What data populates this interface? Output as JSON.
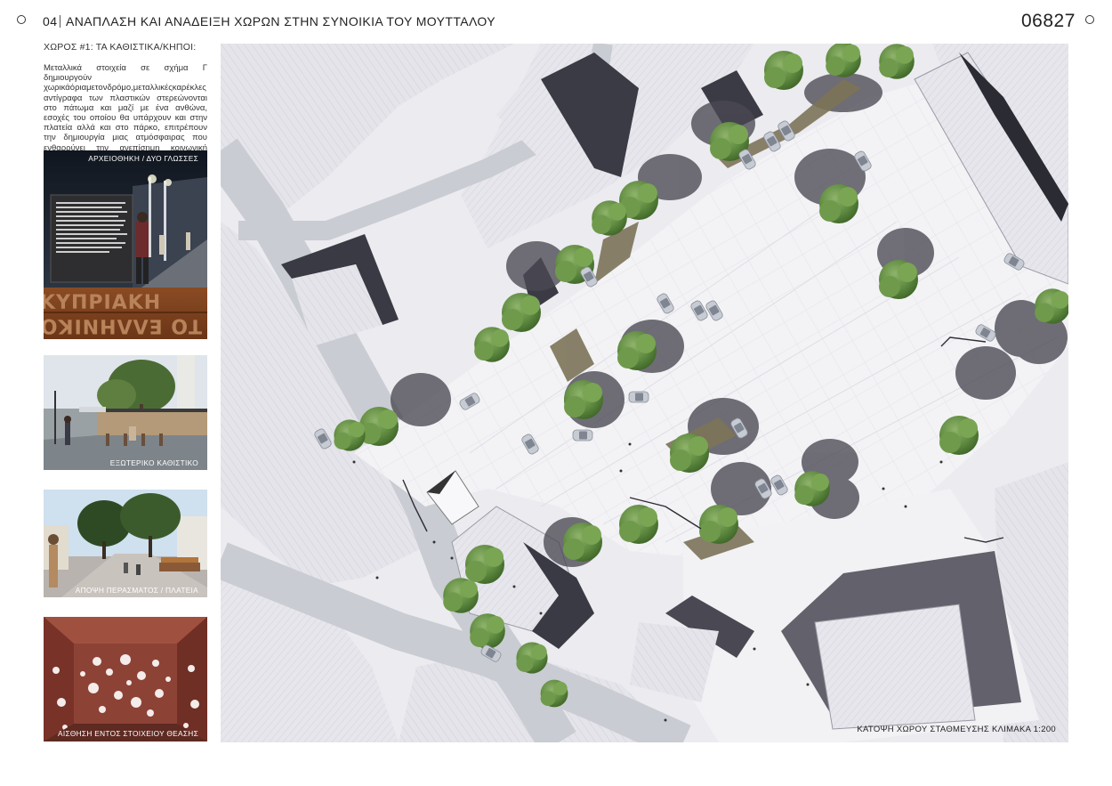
{
  "header": {
    "number": "04",
    "title": "ΑΝΑΠΛΑΣΗ ΚΑΙ ΑΝΑΔΕΙΞΗ ΧΩΡΩΝ ΣΤΗΝ ΣΥΝΟΙΚΙΑ ΤΟΥ ΜΟΥΤΤΑΛΟΥ",
    "code": "06827"
  },
  "sidebar": {
    "heading": "ΧΩΡΟΣ #1: ΤΑ ΚΑΘΙΣΤΙΚΑ/ΚΗΠΟΙ:",
    "description": "Μεταλλικά στοιχεία σε σχήμα Γ δημιουργούν χωρικάόριαμετονδρόμο,μεταλλικέςκαρέκλες αντίγραφα των πλαστικών στερεώνονται στο πάτωμα και μαζί με ένα ανθώνα, εσοχές του οποίου θα υπάρχουν και στην πλατεία αλλά και στο πάρκο, επιτρέπουν την δημιουργία μιας ατμόσφαιρας που ενθαρρύνει την ανεπίσημη κοινωνική συνεύρεση.",
    "images": [
      {
        "caption": "ΑΡΧΕΙΟΘΗΚΗ   / ΔΥΟ ΓΛΩΣΣΕΣ"
      },
      {
        "caption": "ΕΞΩΤΕΡΙΚΟ ΚΑΘΙΣΤΙΚΟ"
      },
      {
        "caption": "ΑΠΟΨΗ ΠΕΡΑΣΜΑΤΟΣ / ΠΛΑΤΕΙΑ"
      },
      {
        "caption": "ΑΙΣΘΗΣΗ ΕΝΤΟΣ ΣΤΟΙΧΕΙΟΥ ΘΕΑΣΗΣ"
      }
    ]
  },
  "plan": {
    "caption": "ΚΑΤΟΨΗ ΧΩΡΟΥ ΣΤΑΘΜΕΥΣΗΣ ΚΛΙΜΑΚΑ 1:200"
  },
  "colors": {
    "ground": "#ebebf0",
    "road": "#c9ccd2",
    "plaza": "#f4f4f6",
    "roof": "#dcdce3",
    "shadow": "#4a4852",
    "tree": "#5f8a43",
    "soil": "#7c7358"
  }
}
